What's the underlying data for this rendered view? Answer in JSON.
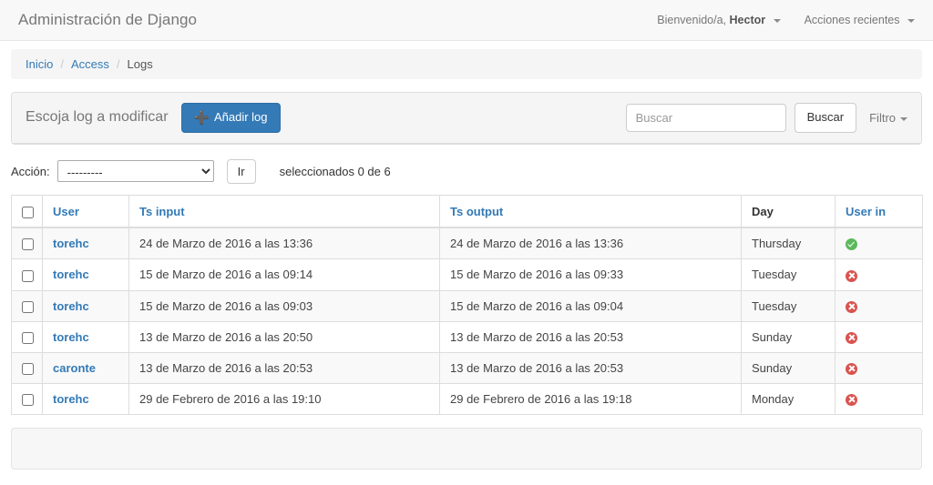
{
  "navbar": {
    "brand": "Administración de Django",
    "welcome_prefix": "Bienvenido/a,",
    "user": "Hector",
    "recent_actions": "Acciones recientes"
  },
  "breadcrumb": {
    "home": "Inicio",
    "app": "Access",
    "current": "Logs",
    "separator": "/"
  },
  "panel": {
    "title": "Escoja log a modificar",
    "add_button": "Añadir log",
    "add_icon": "plus-icon",
    "search": {
      "placeholder": "Buscar",
      "value": "",
      "button": "Buscar"
    },
    "filter": "Filtro"
  },
  "actions": {
    "label": "Acción:",
    "selected_option": "---------",
    "options": [
      "---------"
    ],
    "go_button": "Ir",
    "counter": "seleccionados 0 de 6"
  },
  "table": {
    "columns": [
      {
        "key": "check",
        "label": "",
        "sortable": false
      },
      {
        "key": "user",
        "label": "User",
        "sortable": true
      },
      {
        "key": "tsin",
        "label": "Ts input",
        "sortable": true
      },
      {
        "key": "tsout",
        "label": "Ts output",
        "sortable": true
      },
      {
        "key": "day",
        "label": "Day",
        "sortable": false
      },
      {
        "key": "userin",
        "label": "User in",
        "sortable": true
      }
    ],
    "rows": [
      {
        "user": "torehc",
        "ts_input": "24 de Marzo de 2016 a las 13:36",
        "ts_output": "24 de Marzo de 2016 a las 13:36",
        "day": "Thursday",
        "user_in": "yes",
        "checked": false
      },
      {
        "user": "torehc",
        "ts_input": "15 de Marzo de 2016 a las 09:14",
        "ts_output": "15 de Marzo de 2016 a las 09:33",
        "day": "Tuesday",
        "user_in": "no",
        "checked": false
      },
      {
        "user": "torehc",
        "ts_input": "15 de Marzo de 2016 a las 09:03",
        "ts_output": "15 de Marzo de 2016 a las 09:04",
        "day": "Tuesday",
        "user_in": "no",
        "checked": false
      },
      {
        "user": "torehc",
        "ts_input": "13 de Marzo de 2016 a las 20:50",
        "ts_output": "13 de Marzo de 2016 a las 20:53",
        "day": "Sunday",
        "user_in": "no",
        "checked": false
      },
      {
        "user": "caronte",
        "ts_input": "13 de Marzo de 2016 a las 20:53",
        "ts_output": "13 de Marzo de 2016 a las 20:53",
        "day": "Sunday",
        "user_in": "no",
        "checked": false
      },
      {
        "user": "torehc",
        "ts_input": "29 de Febrero de 2016 a las 19:10",
        "ts_output": "29 de Febrero de 2016 a las 19:18",
        "day": "Monday",
        "user_in": "no",
        "checked": false
      }
    ]
  },
  "colors": {
    "link": "#337ab7",
    "primary_button": "#337ab7",
    "status_yes": "#5cb85c",
    "status_no": "#d9534f",
    "navbar_bg": "#f8f8f8",
    "breadcrumb_bg": "#f5f5f5"
  }
}
